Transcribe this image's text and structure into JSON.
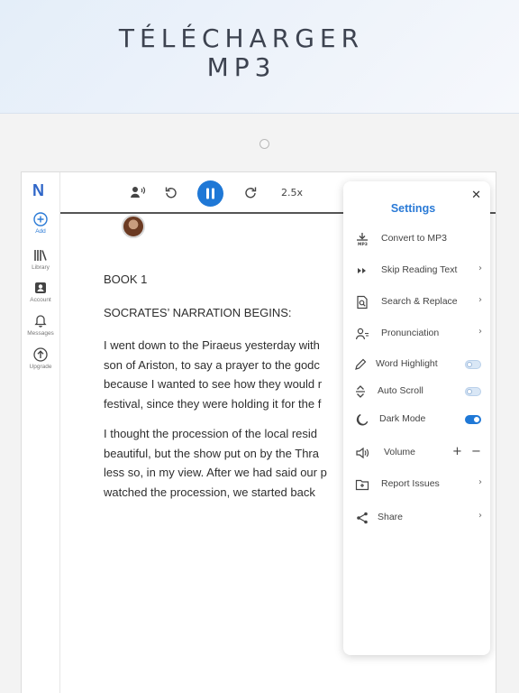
{
  "banner": {
    "line1": "TÉLÉCHARGER",
    "line2": "MP3"
  },
  "sidebar": {
    "logo": "N",
    "items": [
      {
        "label": "Add",
        "icon": "plus-circle-icon"
      },
      {
        "label": "Library",
        "icon": "library-icon"
      },
      {
        "label": "Account",
        "icon": "account-icon"
      },
      {
        "label": "Messages",
        "icon": "bell-icon"
      },
      {
        "label": "Upgrade",
        "icon": "upgrade-icon"
      }
    ]
  },
  "player": {
    "speed": "2.5x",
    "state": "playing"
  },
  "reader": {
    "heading": "BOOK 1",
    "subheading": "SOCRATES’ NARRATION BEGINS:",
    "paragraph1": [
      "I went down to the Piraeus yesterday with",
      "son of Ariston, to say a prayer to the godc",
      "because I wanted to see how they would r",
      "festival, since they were holding it for the f"
    ],
    "paragraph2": [
      "I thought the procession of the local resid",
      "beautiful, but the show put on by the Thra",
      "less so, in my view. After we had said our p",
      "watched the procession, we started back"
    ]
  },
  "settings": {
    "title": "Settings",
    "convert": "Convert to MP3",
    "skip": "Skip Reading Text",
    "search": "Search & Replace",
    "pronunciation": "Pronunciation",
    "word_highlight": {
      "label": "Word Highlight",
      "on": false
    },
    "auto_scroll": {
      "label": "Auto Scroll",
      "on": false
    },
    "dark_mode": {
      "label": "Dark Mode",
      "on": true
    },
    "volume": "Volume",
    "report": "Report Issues",
    "share": "Share",
    "accent": "#1f78d6"
  }
}
